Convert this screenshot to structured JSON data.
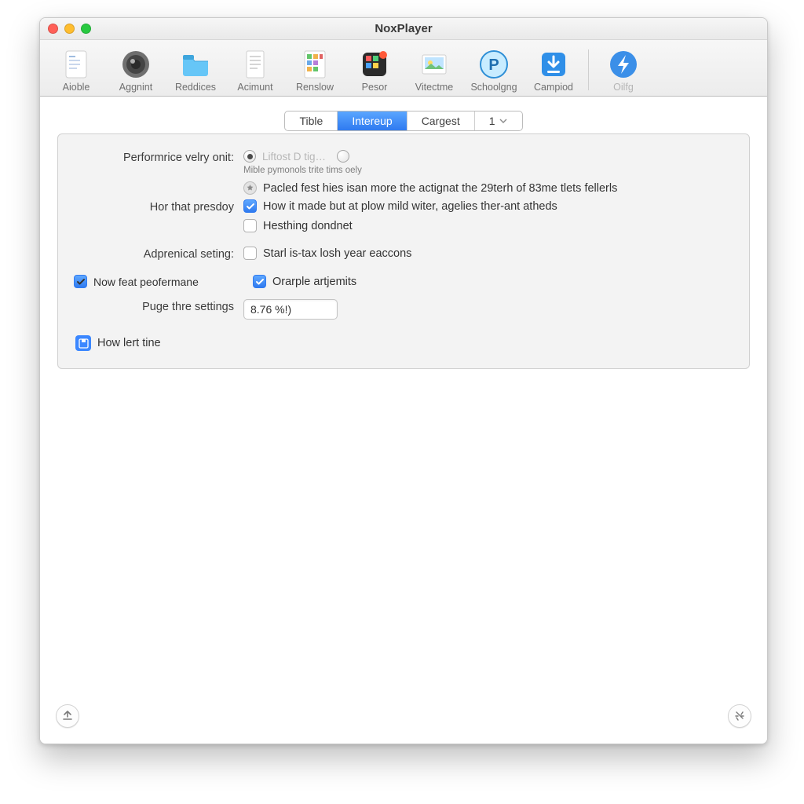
{
  "window": {
    "title": "NoxPlayer"
  },
  "toolbar": {
    "items": [
      {
        "label": "Aioble"
      },
      {
        "label": "Aggnint"
      },
      {
        "label": "Reddices"
      },
      {
        "label": "Acimunt"
      },
      {
        "label": "Renslow"
      },
      {
        "label": "Pesor"
      },
      {
        "label": "Vitectme"
      },
      {
        "label": "Schoolgng"
      },
      {
        "label": "Campiod"
      },
      {
        "label": "Oilfg"
      }
    ]
  },
  "tabs": {
    "items": [
      {
        "label": "Tible"
      },
      {
        "label": "Intereup"
      },
      {
        "label": "Cargest"
      },
      {
        "label": "1"
      }
    ],
    "selectedIndex": 1
  },
  "form": {
    "row1": {
      "label": "Performrice velry onit:",
      "radio1": "Liftost D tig…",
      "note": "Mible pymonols trite tims oely",
      "radio2": "Pacled fest hies isan more the actignat the 29terh of 83me tlets fellerls"
    },
    "row2": {
      "label": "Hor that presdoy",
      "chk1": "How it made but at plow mild witer, agelies ther-ant atheds",
      "chk2": "Hesthing dondnet"
    },
    "row3": {
      "label": "Adprenical seting:",
      "chk": "Starl is-tax losh year eaccons"
    },
    "row4": {
      "leftchk": "Now feat peofermane",
      "chk": "Orarple artjemits"
    },
    "row5": {
      "label": "Puge thre settings",
      "value": "8.76 %!)"
    },
    "row6": {
      "label": "How lert tine"
    }
  }
}
